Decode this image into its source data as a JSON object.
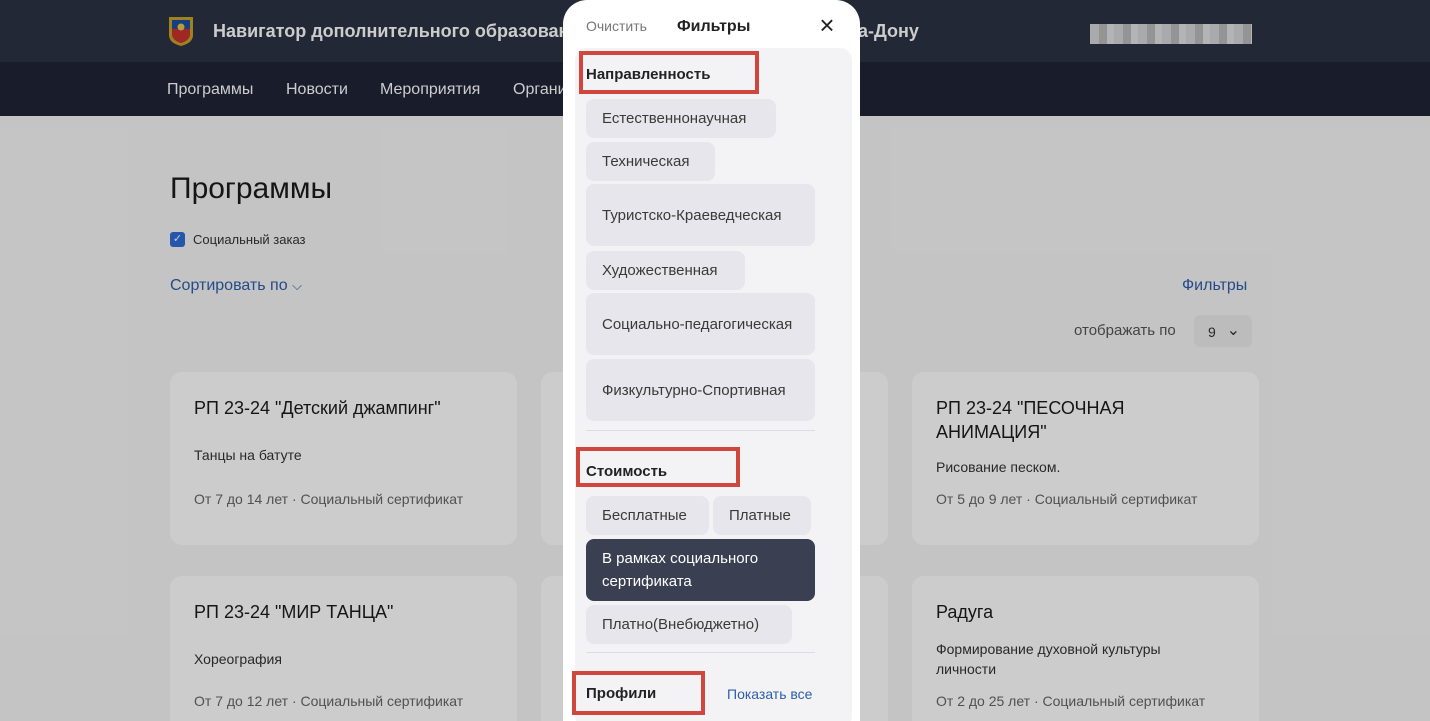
{
  "header": {
    "title": "Навигатор дополнительного образовани",
    "title_tail": "а-Дону"
  },
  "nav": {
    "items": [
      "Программы",
      "Новости",
      "Мероприятия",
      "Органи"
    ]
  },
  "main": {
    "page_title": "Программы",
    "social_order_label": "Социальный заказ",
    "sort_label": "Сортировать по",
    "filters_link": "Фильтры",
    "per_page_label": "отображать по",
    "per_page_value": "9"
  },
  "cards": [
    {
      "title": "РП 23-24 \"Детский джампинг\"",
      "desc": "Танцы на батуте",
      "meta": "От 7 до 14 лет · Социальный сертификат"
    },
    {
      "title": "РП 23-24 \"ПЕСОЧНАЯ АНИМАЦИЯ\"",
      "desc": "Рисование песком.",
      "meta": "От 5 до 9 лет · Социальный сертификат"
    },
    {
      "title": "РП 23-24 \"МИР ТАНЦА\"",
      "desc": "Хореография",
      "meta": "От 7 до 12 лет · Социальный сертификат"
    },
    {
      "title": "Радуга",
      "desc": "Формирование духовной культуры личности",
      "meta": "От 2 до 25 лет · Социальный сертификат"
    }
  ],
  "modal": {
    "clear": "Очистить",
    "title": "Фильтры",
    "sections": {
      "direction": "Направленность",
      "cost": "Стоимость",
      "profiles": "Профили"
    },
    "direction_chips": [
      "Естественнонаучная",
      "Техническая",
      "Туристско-Краеведческая",
      "Художественная",
      "Социально-педагогическая",
      "Физкультурно-Спортивная"
    ],
    "cost_chips": [
      "Бесплатные",
      "Платные",
      "В рамках социального сертификата",
      "Платно(Внебюджетно)"
    ],
    "show_all": "Показать все"
  },
  "colors": {
    "header_bg": "#2c3244",
    "nav_bg": "#1e2336",
    "accent": "#2d5ea9",
    "chip_active": "#3a3f51",
    "highlight": "#d0473e"
  }
}
